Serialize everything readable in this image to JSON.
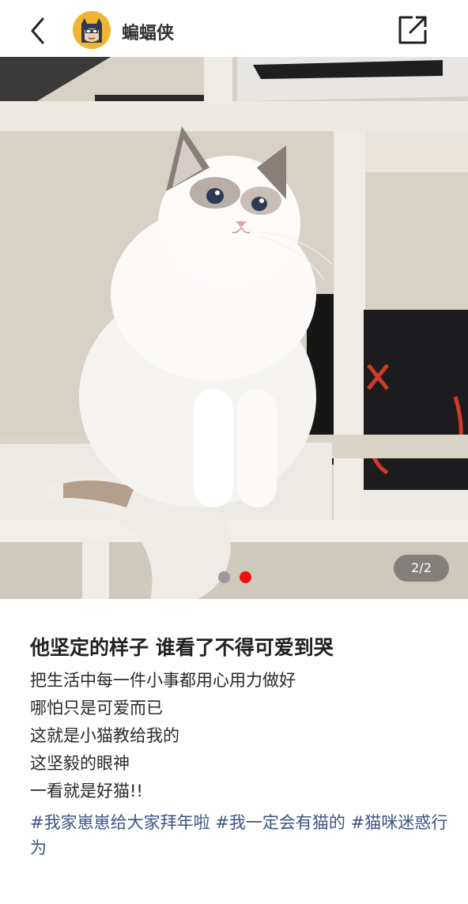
{
  "header": {
    "back_icon": "chevron-left-icon",
    "username": "蝙蝠侠",
    "avatar_icon": "batman-avatar",
    "share_icon": "external-link-icon"
  },
  "photo": {
    "counter": "2/2",
    "current_index": 2,
    "total": 2
  },
  "post": {
    "title": "他坚定的样子 谁看了不得可爱到哭",
    "lines": [
      "把生活中每一件小事都用心用力做好",
      "哪怕只是可爱而已",
      "这就是小猫教给我的",
      "这坚毅的眼神",
      "一看就是好猫!!"
    ],
    "tags": [
      "#我家崽崽给大家拜年啦",
      "#我一定会有猫的",
      "#猫咪迷惑行为"
    ]
  },
  "colors": {
    "tag": "#3a5685",
    "dot_active": "#ee1111",
    "dot_inactive": "#9a9a9a"
  }
}
